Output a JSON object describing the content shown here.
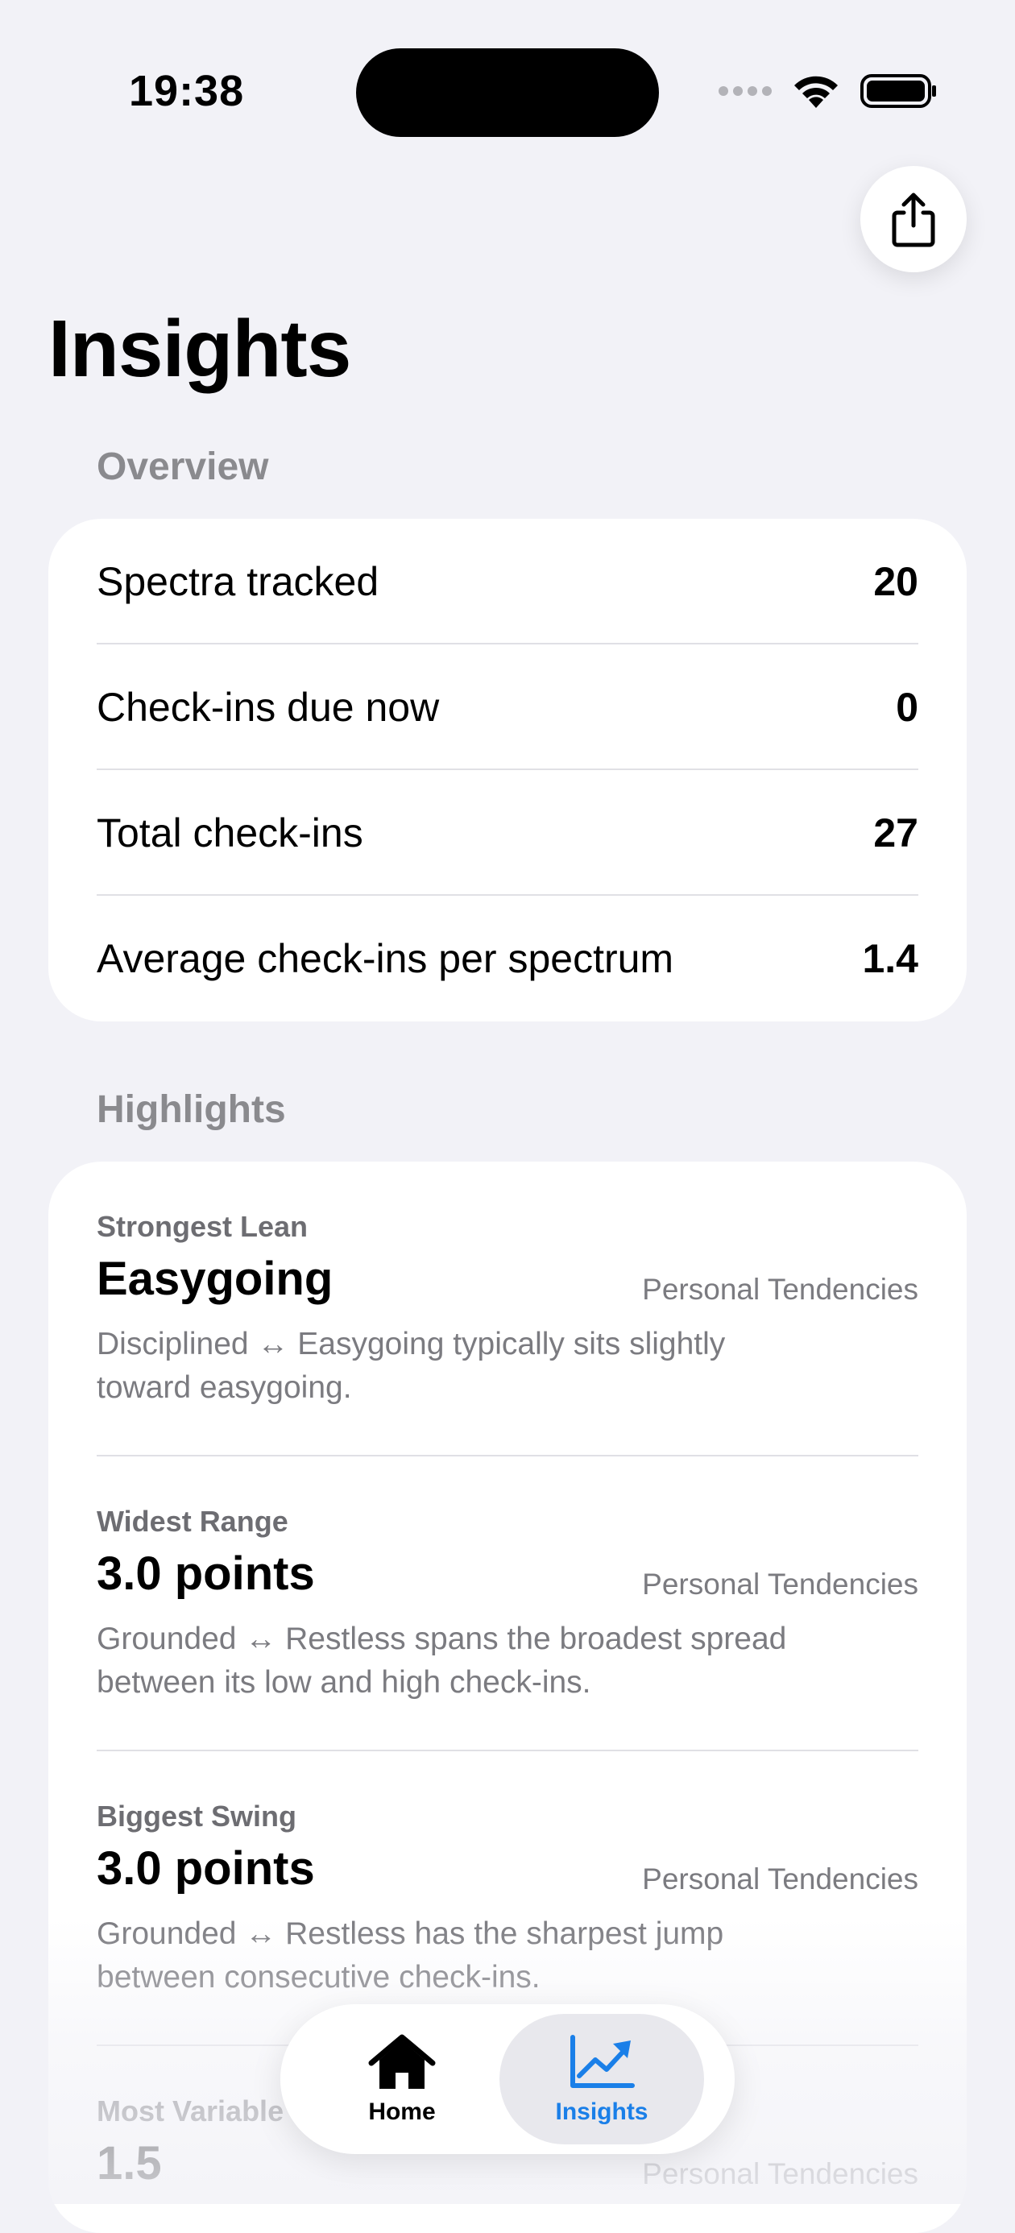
{
  "status_bar": {
    "time": "19:38"
  },
  "header": {
    "title": "Insights",
    "share_icon": "share-icon"
  },
  "overview": {
    "header": "Overview",
    "rows": [
      {
        "label": "Spectra tracked",
        "value": "20"
      },
      {
        "label": "Check-ins due now",
        "value": "0"
      },
      {
        "label": "Total check-ins",
        "value": "27"
      },
      {
        "label": "Average check-ins per spectrum",
        "value": "1.4"
      }
    ]
  },
  "highlights": {
    "header": "Highlights",
    "items": [
      {
        "label": "Strongest Lean",
        "value": "Easygoing",
        "category": "Personal Tendencies",
        "description": "Disciplined ↔ Easygoing typically sits slightly toward easygoing."
      },
      {
        "label": "Widest Range",
        "value": "3.0 points",
        "category": "Personal Tendencies",
        "description": "Grounded ↔ Restless spans the broadest spread between its low and high check-ins."
      },
      {
        "label": "Biggest Swing",
        "value": "3.0 points",
        "category": "Personal Tendencies",
        "description": "Grounded ↔ Restless has the sharpest jump between consecutive check-ins."
      },
      {
        "label": "Most Variable",
        "value": "1.5",
        "category": "Personal Tendencies",
        "description": ""
      }
    ]
  },
  "tab_bar": {
    "tabs": [
      {
        "label": "Home",
        "icon": "house-icon",
        "selected": false
      },
      {
        "label": "Insights",
        "icon": "chart-line-icon",
        "selected": true
      }
    ],
    "accent": "#1a7fe8"
  }
}
